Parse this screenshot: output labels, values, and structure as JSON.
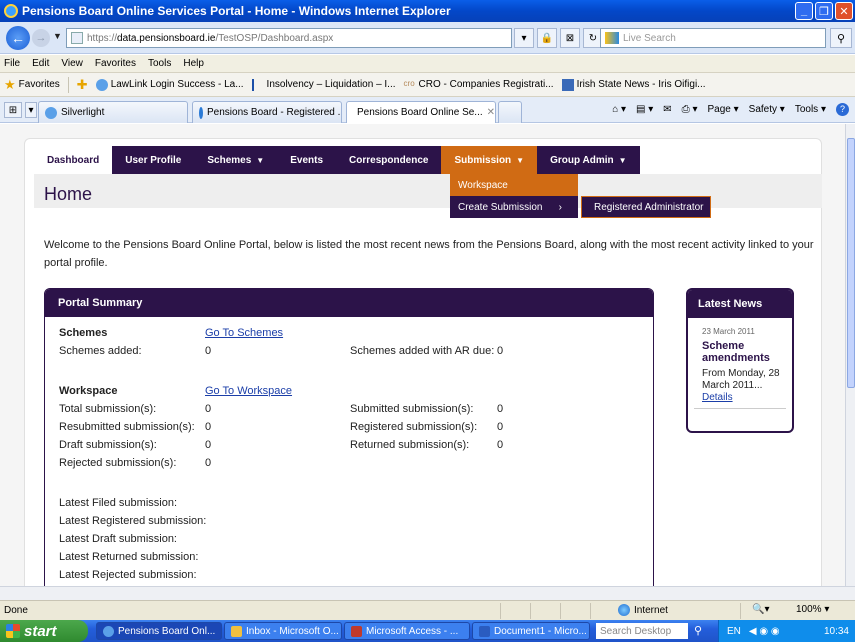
{
  "window": {
    "title": "Pensions Board Online Services Portal - Home - Windows Internet Explorer"
  },
  "address": {
    "proto": "https://",
    "host": "data.pensionsboard.ie",
    "path": "/TestOSP/Dashboard.aspx",
    "search_placeholder": "Live Search"
  },
  "menubar": [
    "File",
    "Edit",
    "View",
    "Favorites",
    "Tools",
    "Help"
  ],
  "favorites": {
    "label": "Favorites",
    "items": [
      "LawLink Login Success - La...",
      "Insolvency – Liquidation – I...",
      "CRO - Companies Registrati...",
      "Irish State News - Iris Oifigi..."
    ]
  },
  "tabs": {
    "silverlight": "Silverlight",
    "tab1": "Pensions Board - Registered ...",
    "tab2": "Pensions Board Online Se...",
    "tools": [
      "Page",
      "Safety",
      "Tools"
    ]
  },
  "nav": {
    "dashboard": "Dashboard",
    "user_profile": "User Profile",
    "schemes": "Schemes",
    "events": "Events",
    "correspondence": "Correspondence",
    "submission": "Submission",
    "group_admin": "Group Admin"
  },
  "dropdown": {
    "workspace": "Workspace",
    "create_submission": "Create Submission",
    "registered_admin": "Registered Administrator"
  },
  "page": {
    "title": "Home",
    "welcome": "Welcome to the Pensions Board Online Portal, below is listed the most recent news from the Pensions Board, along with the most recent activity linked to your portal profile."
  },
  "summary": {
    "header": "Portal Summary",
    "schemes_label": "Schemes",
    "go_schemes": "Go To Schemes",
    "schemes_added_label": "Schemes added:",
    "schemes_added_value": "0",
    "schemes_ar_label": "Schemes added with AR due:",
    "schemes_ar_value": "0",
    "workspace_label": "Workspace",
    "go_workspace": "Go To Workspace",
    "total_label": "Total submission(s):",
    "total_value": "0",
    "submitted_label": "Submitted submission(s):",
    "submitted_value": "0",
    "resubmitted_label": "Resubmitted submission(s):",
    "resubmitted_value": "0",
    "registered_label": "Registered submission(s):",
    "registered_value": "0",
    "draft_label": "Draft submission(s):",
    "draft_value": "0",
    "returned_label": "Returned submission(s):",
    "returned_value": "0",
    "rejected_label": "Rejected submission(s):",
    "rejected_value": "0",
    "latest_filed": "Latest Filed submission:",
    "latest_registered": "Latest Registered submission:",
    "latest_draft": "Latest Draft submission:",
    "latest_returned": "Latest Returned submission:",
    "latest_rejected": "Latest Rejected submission:"
  },
  "news": {
    "header": "Latest News",
    "date": "23 March 2011",
    "title": "Scheme amendments",
    "body": "From Monday, 28 March 2011...",
    "details": "Details"
  },
  "status": {
    "text": "Done",
    "zone": "Internet",
    "zoom": "100%"
  },
  "taskbar": {
    "start": "start",
    "tasks": [
      "Pensions Board Onl...",
      "Inbox - Microsoft O...",
      "Microsoft Access - ...",
      "Document1 - Micro..."
    ],
    "search_placeholder": "Search Desktop",
    "lang": "EN",
    "time": "10:34"
  },
  "colors": {
    "brand_purple": "#2c1349",
    "accent_orange": "#d06b14"
  }
}
